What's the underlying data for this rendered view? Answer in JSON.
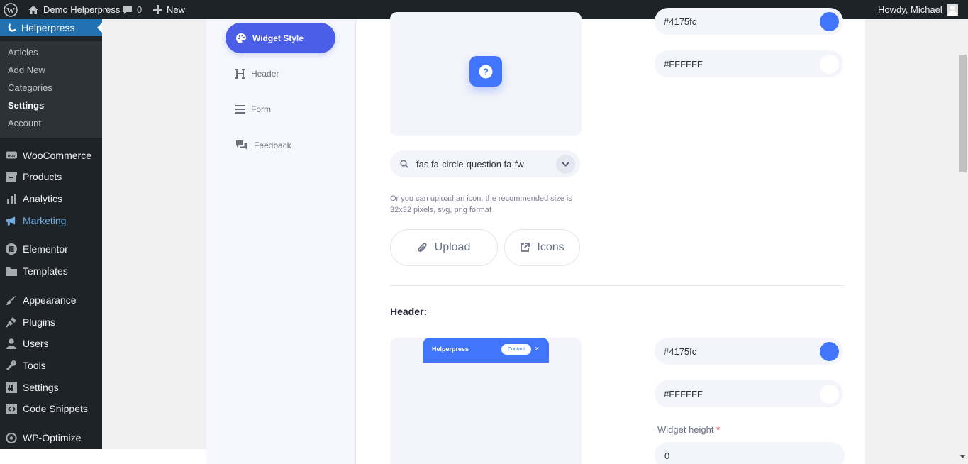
{
  "adminbar": {
    "site_name": "Demo Helperpress",
    "comments_count": "0",
    "new_label": "New",
    "greeting": "Howdy, Michael"
  },
  "sidebar": {
    "current": "Helperpress",
    "submenu": [
      "Articles",
      "Add New",
      "Categories",
      "Settings",
      "Account"
    ],
    "items": [
      {
        "label": "WooCommerce",
        "icon": "woo-icon"
      },
      {
        "label": "Products",
        "icon": "archive-icon"
      },
      {
        "label": "Analytics",
        "icon": "bar-chart-icon"
      },
      {
        "label": "Marketing",
        "icon": "megaphone-icon"
      },
      {
        "label": "Elementor",
        "icon": "elementor-icon"
      },
      {
        "label": "Templates",
        "icon": "folder-icon"
      },
      {
        "label": "Appearance",
        "icon": "brush-icon"
      },
      {
        "label": "Plugins",
        "icon": "plug-icon"
      },
      {
        "label": "Users",
        "icon": "user-icon"
      },
      {
        "label": "Tools",
        "icon": "wrench-icon"
      },
      {
        "label": "Settings",
        "icon": "settings-icon"
      },
      {
        "label": "Code Snippets",
        "icon": "code-icon"
      },
      {
        "label": "WP-Optimize",
        "icon": "optimize-icon"
      }
    ]
  },
  "settings_nav": {
    "widget_style": "Widget Style",
    "header": "Header",
    "form": "Form",
    "feedback": "Feedback"
  },
  "widget": {
    "color1": "#4175fc",
    "color2": "#FFFFFF",
    "icon_value": "fas fa-circle-question fa-fw",
    "upload_hint": "Or you can upload an icon, the recommended size is 32x32 pixels, svg, png format",
    "upload_label": "Upload",
    "icons_label": "Icons"
  },
  "header_section": {
    "title": "Header:",
    "preview_brand": "Helperpress",
    "preview_contact": "Contact",
    "color1": "#4175fc",
    "color2": "#FFFFFF",
    "height_label": "Widget height",
    "height_value": "0"
  },
  "colors": {
    "accent": "#4175fc",
    "nav_active": "#4a5ee8",
    "wp_blue": "#2271b1"
  }
}
